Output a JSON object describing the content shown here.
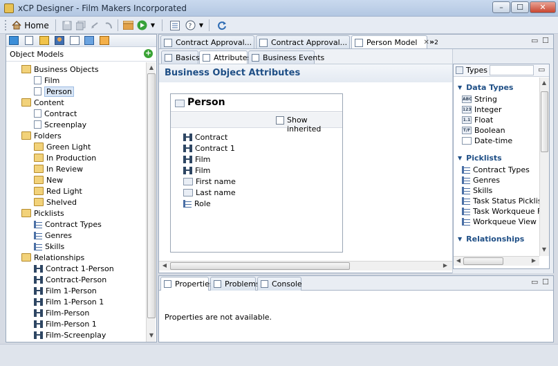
{
  "window": {
    "title": "xCP Designer - Film Makers Incorporated",
    "controls": {
      "minimize": "–",
      "maximize": "☐",
      "close": "✕"
    }
  },
  "toolbar": {
    "home_label": "Home"
  },
  "left_panel": {
    "title": "Object Models",
    "tree": [
      {
        "label": "Business Objects",
        "icon": "business-objects-folder-icon",
        "level": 0
      },
      {
        "label": "Film",
        "icon": "document-icon",
        "level": 1
      },
      {
        "label": "Person",
        "icon": "document-icon",
        "level": 1,
        "selected": true
      },
      {
        "label": "Content",
        "icon": "folder-icon",
        "level": 0
      },
      {
        "label": "Contract",
        "icon": "document-icon",
        "level": 1
      },
      {
        "label": "Screenplay",
        "icon": "document-icon",
        "level": 1
      },
      {
        "label": "Folders",
        "icon": "folder-icon",
        "level": 0
      },
      {
        "label": "Green Light",
        "icon": "folder-icon",
        "level": 1
      },
      {
        "label": "In Production",
        "icon": "folder-icon",
        "level": 1
      },
      {
        "label": "In Review",
        "icon": "folder-icon",
        "level": 1
      },
      {
        "label": "New",
        "icon": "folder-icon",
        "level": 1
      },
      {
        "label": "Red Light",
        "icon": "folder-icon",
        "level": 1
      },
      {
        "label": "Shelved",
        "icon": "folder-icon",
        "level": 1
      },
      {
        "label": "Picklists",
        "icon": "folder-icon",
        "level": 0
      },
      {
        "label": "Contract Types",
        "icon": "picklist-icon",
        "level": 1
      },
      {
        "label": "Genres",
        "icon": "picklist-icon",
        "level": 1
      },
      {
        "label": "Skills",
        "icon": "picklist-icon",
        "level": 1
      },
      {
        "label": "Relationships",
        "icon": "folder-icon",
        "level": 0
      },
      {
        "label": "Contract 1-Person",
        "icon": "relationship-icon",
        "level": 1
      },
      {
        "label": "Contract-Person",
        "icon": "relationship-icon",
        "level": 1
      },
      {
        "label": "Film 1-Person",
        "icon": "relationship-icon",
        "level": 1
      },
      {
        "label": "Film 1-Person 1",
        "icon": "relationship-icon",
        "level": 1
      },
      {
        "label": "Film-Person",
        "icon": "relationship-icon",
        "level": 1
      },
      {
        "label": "Film-Person 1",
        "icon": "relationship-icon",
        "level": 1
      },
      {
        "label": "Film-Screenplay",
        "icon": "relationship-icon",
        "level": 1
      }
    ]
  },
  "editor_tabs": [
    {
      "label": "Contract Approval...",
      "active": false
    },
    {
      "label": "Contract Approval...",
      "active": false
    },
    {
      "label": "Person Model",
      "active": true,
      "close": "✕"
    }
  ],
  "overflow_tabs": {
    "label": "»",
    "count": "2"
  },
  "subtabs": [
    {
      "label": "Basics"
    },
    {
      "label": "Attributes",
      "active": true
    },
    {
      "label": "Business Events"
    }
  ],
  "editor": {
    "heading": "Business Object Attributes",
    "card_title": "Person",
    "show_inherited_label": "Show inherited",
    "attributes": [
      {
        "label": "Contract",
        "icon": "relationship-icon"
      },
      {
        "label": "Contract 1",
        "icon": "relationship-icon"
      },
      {
        "label": "Film",
        "icon": "relationship-icon"
      },
      {
        "label": "Film",
        "icon": "relationship-icon"
      },
      {
        "label": "First name",
        "icon": "string-icon"
      },
      {
        "label": "Last name",
        "icon": "string-icon"
      },
      {
        "label": "Role",
        "icon": "picklist-icon"
      }
    ]
  },
  "palette": {
    "title": "Types",
    "sections": [
      {
        "title": "Data Types",
        "items": [
          {
            "label": "String",
            "badge": "ABC"
          },
          {
            "label": "Integer",
            "badge": "123"
          },
          {
            "label": "Float",
            "badge": "1.1"
          },
          {
            "label": "Boolean",
            "badge": "T/F"
          },
          {
            "label": "Date-time",
            "badge": ""
          }
        ]
      },
      {
        "title": "Picklists",
        "items": [
          {
            "label": "Contract Types"
          },
          {
            "label": "Genres"
          },
          {
            "label": "Skills"
          },
          {
            "label": "Task Status Picklist"
          },
          {
            "label": "Task Workqueue Fla"
          },
          {
            "label": "Workqueue View F"
          }
        ]
      },
      {
        "title": "Relationships",
        "items": []
      }
    ]
  },
  "bottom_panel": {
    "tabs": [
      {
        "label": "Properties",
        "active": true
      },
      {
        "label": "Problems"
      },
      {
        "label": "Console"
      }
    ],
    "message": "Properties are not available."
  }
}
